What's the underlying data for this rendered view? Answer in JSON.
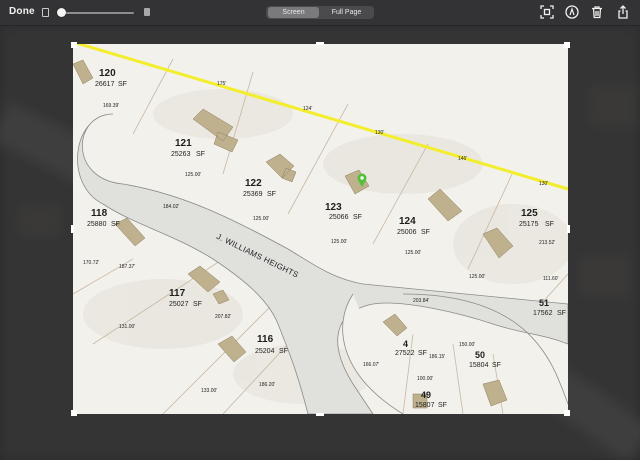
{
  "toolbar": {
    "done_label": "Done",
    "zoom_level": 0.0,
    "segments": {
      "screen_label": "Screen",
      "full_page_label": "Full Page",
      "selected": "Screen"
    },
    "icons": [
      "small-page-icon",
      "large-page-icon",
      "crop-icon",
      "markup-icon",
      "trash-icon",
      "share-icon"
    ]
  },
  "map": {
    "street_name": "J. WILLIAMS HEIGHTS",
    "lots": [
      {
        "number": "120",
        "area": "26617",
        "unit": "SF"
      },
      {
        "number": "121",
        "area": "25263",
        "unit": "SF"
      },
      {
        "number": "122",
        "area": "25369",
        "unit": "SF"
      },
      {
        "number": "123",
        "area": "25066",
        "unit": "SF"
      },
      {
        "number": "124",
        "area": "25006",
        "unit": "SF"
      },
      {
        "number": "125",
        "area": "25175",
        "unit": "SF"
      },
      {
        "number": "118",
        "area": "25880",
        "unit": "SF"
      },
      {
        "number": "117",
        "area": "25027",
        "unit": "SF"
      },
      {
        "number": "116",
        "area": "25204",
        "unit": "SF"
      },
      {
        "number": "4",
        "area": "27522",
        "unit": "SF"
      },
      {
        "number": "50",
        "area": "15804",
        "unit": "SF"
      },
      {
        "number": "49",
        "area": "15807",
        "unit": "SF"
      },
      {
        "number": "51",
        "area": "17562",
        "unit": "SF"
      }
    ],
    "dims": [
      "169.39'",
      "175'",
      "124'",
      "130'",
      "146'",
      "130'",
      "125.00'",
      "125.00'",
      "125.00'",
      "125.00'",
      "125.00'",
      "203.84'",
      "187.37'",
      "207.82'",
      "131.00'",
      "186.20'",
      "133.00'",
      "166.07'",
      "186.15'",
      "100.00'",
      "150.00'",
      "111.60'",
      "213.52'",
      "170.72'",
      "184.02'"
    ],
    "marker_color": "#4fc23a",
    "boundary_color": "#f2ee2b"
  }
}
